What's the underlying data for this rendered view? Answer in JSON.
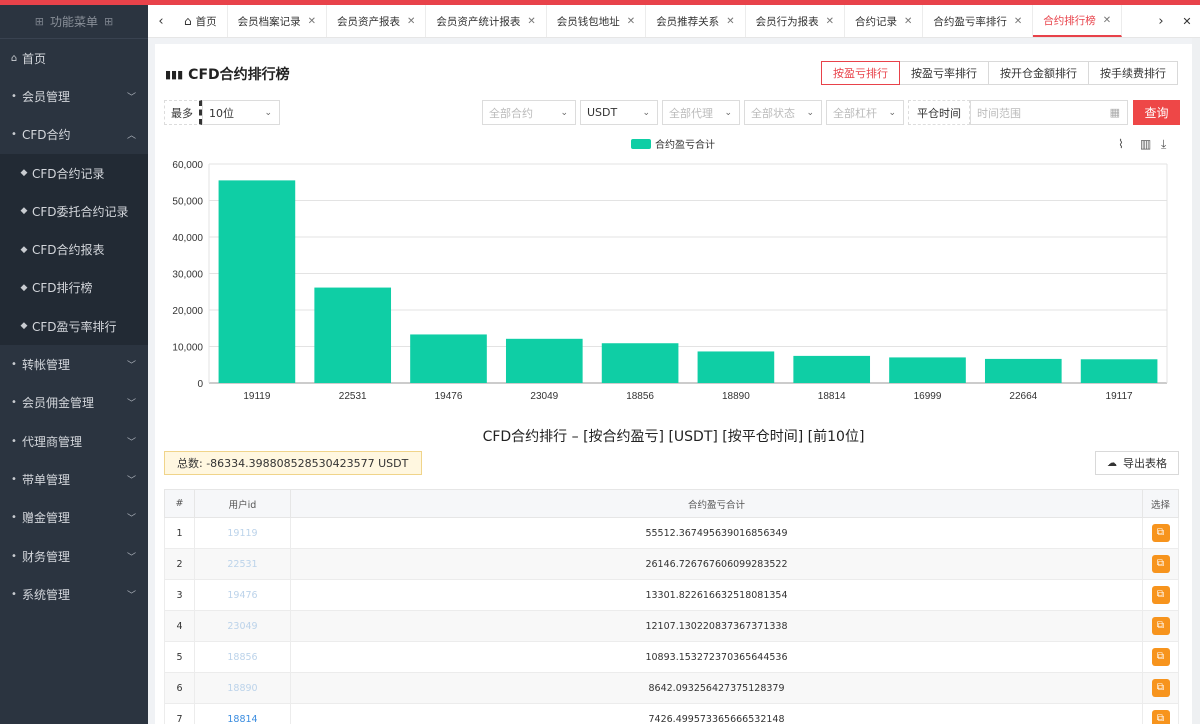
{
  "sidebar": {
    "title": "功能菜单",
    "items": [
      {
        "label": "首页",
        "icon": "home-icon",
        "type": "top"
      },
      {
        "label": "会员管理",
        "icon": "dot-icon",
        "type": "group",
        "open": false
      },
      {
        "label": "CFD合约",
        "icon": "dot-icon",
        "type": "group",
        "open": true
      },
      {
        "label": "CFD合约记录",
        "icon": "diamond-icon",
        "type": "sub"
      },
      {
        "label": "CFD委托合约记录",
        "icon": "diamond-icon",
        "type": "sub"
      },
      {
        "label": "CFD合约报表",
        "icon": "diamond-icon",
        "type": "sub"
      },
      {
        "label": "CFD排行榜",
        "icon": "diamond-icon",
        "type": "sub"
      },
      {
        "label": "CFD盈亏率排行",
        "icon": "diamond-icon",
        "type": "sub"
      },
      {
        "label": "转帐管理",
        "icon": "dot-icon",
        "type": "group",
        "open": false
      },
      {
        "label": "会员佣金管理",
        "icon": "dot-icon",
        "type": "group",
        "open": false
      },
      {
        "label": "代理商管理",
        "icon": "dot-icon",
        "type": "group",
        "open": false
      },
      {
        "label": "带单管理",
        "icon": "dot-icon",
        "type": "group",
        "open": false
      },
      {
        "label": "赠金管理",
        "icon": "dot-icon",
        "type": "group",
        "open": false
      },
      {
        "label": "财务管理",
        "icon": "dot-icon",
        "type": "group",
        "open": false
      },
      {
        "label": "系统管理",
        "icon": "dot-icon",
        "type": "group",
        "open": false
      }
    ]
  },
  "tabs": [
    {
      "label": "首页",
      "closable": false,
      "home": true
    },
    {
      "label": "会员档案记录",
      "closable": true
    },
    {
      "label": "会员资产报表",
      "closable": true
    },
    {
      "label": "会员资产统计报表",
      "closable": true
    },
    {
      "label": "会员钱包地址",
      "closable": true
    },
    {
      "label": "会员推荐关系",
      "closable": true
    },
    {
      "label": "会员行为报表",
      "closable": true
    },
    {
      "label": "合约记录",
      "closable": true
    },
    {
      "label": "合约盈亏率排行",
      "closable": true
    },
    {
      "label": "合约排行榜",
      "closable": true,
      "active": true
    }
  ],
  "page": {
    "title": "CFD合约排行榜",
    "sort_buttons": [
      "按盈亏排行",
      "按盈亏率排行",
      "按开仓金额排行",
      "按手续费排行"
    ],
    "active_sort": 0
  },
  "filters": {
    "limit_label": "最多",
    "limit_value": "10位",
    "contract_placeholder": "全部合约",
    "currency_value": "USDT",
    "agent_placeholder": "全部代理",
    "status_placeholder": "全部状态",
    "leverage_placeholder": "全部杠杆",
    "close_time_label": "平仓时间",
    "time_range_placeholder": "时间范围",
    "query_label": "查询"
  },
  "chart_data": {
    "type": "bar",
    "categories": [
      "19119",
      "22531",
      "19476",
      "23049",
      "18856",
      "18890",
      "18814",
      "16999",
      "22664",
      "19117"
    ],
    "series": [
      {
        "name": "合约盈亏合计",
        "values": [
          55512.37,
          26146.73,
          13301.82,
          12107.13,
          10893.15,
          8642.09,
          7426.5,
          7010,
          6600,
          6500
        ]
      }
    ],
    "ylim": [
      0,
      60000
    ],
    "yticks": [
      "0",
      "10,000",
      "20,000",
      "30,000",
      "40,000",
      "50,000",
      "60,000"
    ],
    "grid": true,
    "legend_position": "top-center",
    "color": "#0fcea5"
  },
  "table": {
    "title": "CFD合约排行 – [按合约盈亏] [USDT] [按平仓时间] [前10位]",
    "total": "总数: -86334.398808528530423577 USDT",
    "export_label": "导出表格",
    "headers": [
      "#",
      "用户id",
      "合约盈亏合计",
      "选择"
    ],
    "rows": [
      {
        "rank": "1",
        "uid": "19119",
        "value": "55512.367495639016856349"
      },
      {
        "rank": "2",
        "uid": "22531",
        "value": "26146.726767606099283522"
      },
      {
        "rank": "3",
        "uid": "19476",
        "value": "13301.822616632518081354"
      },
      {
        "rank": "4",
        "uid": "23049",
        "value": "12107.130220837367371338"
      },
      {
        "rank": "5",
        "uid": "18856",
        "value": "10893.153272370365644536"
      },
      {
        "rank": "6",
        "uid": "18890",
        "value": "8642.093256427375128379"
      },
      {
        "rank": "7",
        "uid": "18814",
        "value": "7426.499573365666532148"
      }
    ]
  }
}
